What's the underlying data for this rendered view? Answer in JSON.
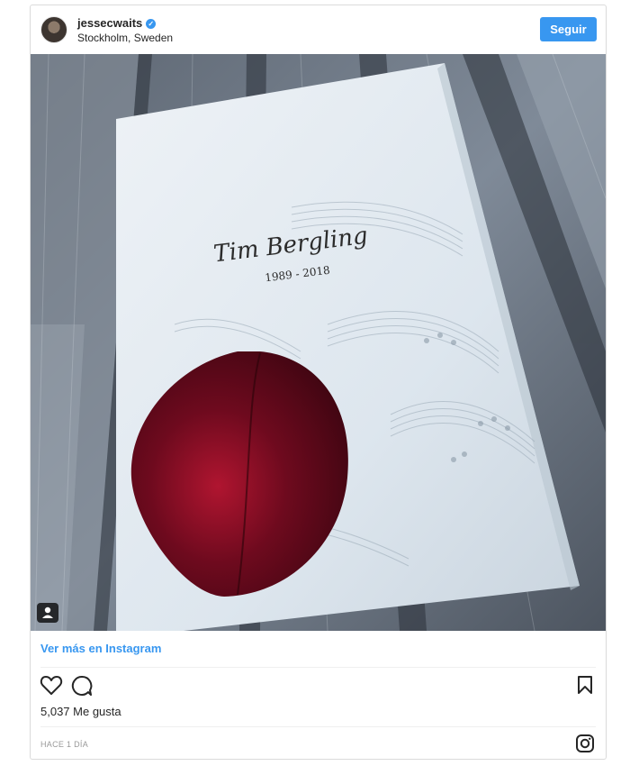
{
  "post": {
    "username": "jessecwaits",
    "location": "Stockholm, Sweden",
    "follow_label": "Seguir",
    "more_link": "Ver más en Instagram",
    "likes": "5,037 Me gusta",
    "timestamp": "HACE 1 DÍA"
  },
  "photo": {
    "booklet_title": "Tim Bergling",
    "booklet_years": "1989 - 2018"
  },
  "colors": {
    "accent": "#3897f0",
    "text": "#262626",
    "muted": "#999999"
  },
  "icons": [
    "verified-badge-icon",
    "user-tag-icon",
    "heart-icon",
    "comment-icon",
    "bookmark-icon",
    "instagram-logo-icon"
  ]
}
